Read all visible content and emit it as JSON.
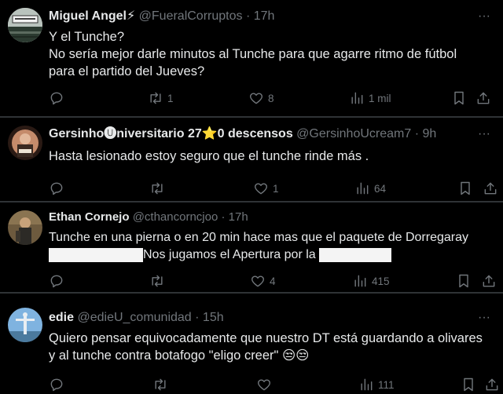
{
  "colors": {
    "background": "#000000",
    "text": "#e7e9ea",
    "muted": "#71767b",
    "divider": "#2f3336"
  },
  "tweets": [
    {
      "name": "Miguel Angel⚡",
      "handle": "@FueralCorruptos",
      "separator": "·",
      "time": "17h",
      "more": "···",
      "lines": [
        "Y el Tunche?",
        "No sería mejor darle minutos al Tunche para que agarre ritmo de  fútbol",
        "para el partido del Jueves?"
      ],
      "reply_count": "",
      "retweet_count": "1",
      "like_count": "8",
      "view_count": "1 mil"
    },
    {
      "name": "Gersinho🅤niversitario 27⭐0 descensos",
      "handle": "@GersinhoUcream7",
      "separator": "·",
      "time": "9h",
      "more": "···",
      "lines": [
        "Hasta lesionado estoy seguro que el tunche rinde más ."
      ],
      "reply_count": "",
      "retweet_count": "",
      "like_count": "1",
      "view_count": "64"
    },
    {
      "name": "Ethan Cornejo",
      "handle": "@cthancorncjoo",
      "separator": "·",
      "time": "17h",
      "more": "",
      "line1": "Tunche en una pierna o en 20 min hace mas que el paquete de Dorregaray",
      "line2_mid": "Nos jugamos el Apertura por la",
      "reply_count": "",
      "retweet_count": "",
      "like_count": "4",
      "view_count": "415"
    },
    {
      "name": "edie",
      "handle": "@edieU_comunidad",
      "separator": "·",
      "time": "15h",
      "more": "···",
      "lines": [
        "Quiero pensar equivocadamente que nuestro DT está guardando a olivares",
        "y al tunche contra botafogo \"eligo creer\" 😒😒"
      ],
      "reply_count": "",
      "retweet_count": "",
      "like_count": "",
      "view_count": "111"
    }
  ]
}
